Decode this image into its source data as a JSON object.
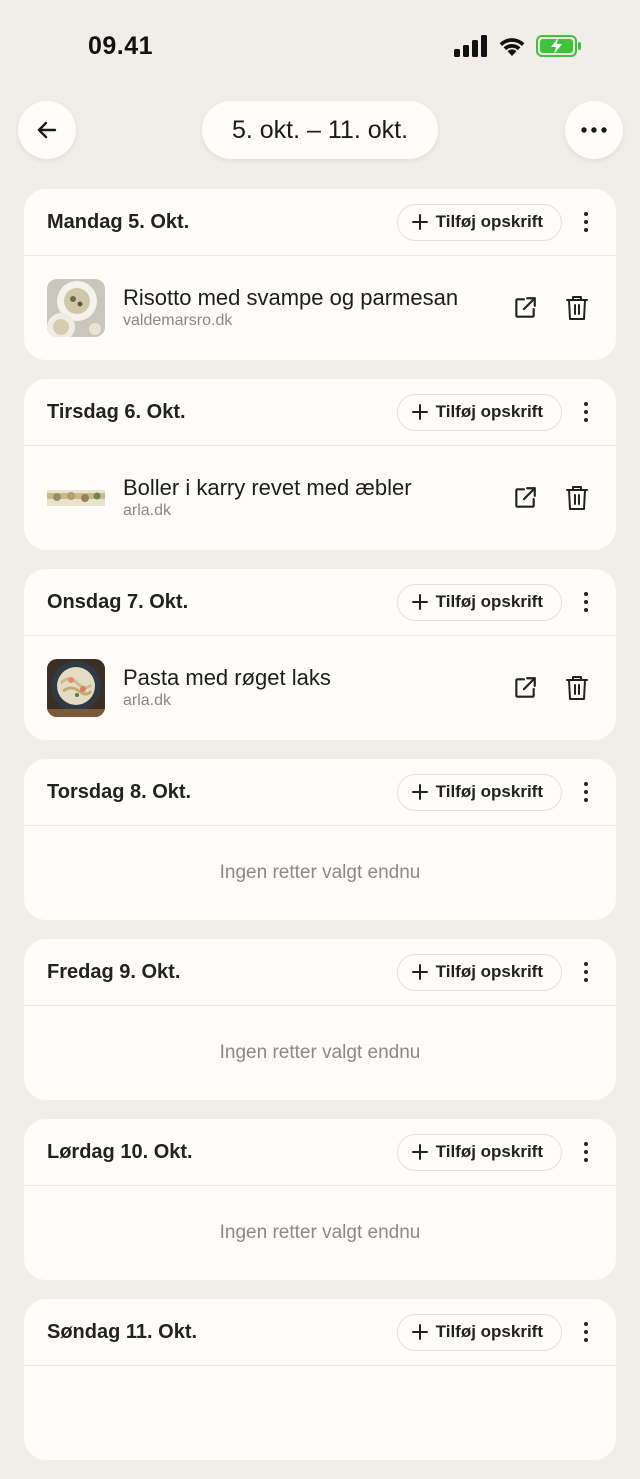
{
  "status": {
    "time": "09.41"
  },
  "nav": {
    "week_range": "5. okt. – 11. okt."
  },
  "add_label": "Tilføj opskrift",
  "empty_label": "Ingen retter valgt endnu",
  "days": [
    {
      "title": "Mandag 5. Okt.",
      "recipe": {
        "title": "Risotto med svampe og parmesan",
        "source": "valdemarsro.dk"
      }
    },
    {
      "title": "Tirsdag 6. Okt.",
      "recipe": {
        "title": "Boller i karry revet med æbler",
        "source": "arla.dk"
      }
    },
    {
      "title": "Onsdag 7. Okt.",
      "recipe": {
        "title": "Pasta med røget laks",
        "source": "arla.dk"
      }
    },
    {
      "title": "Torsdag 8. Okt."
    },
    {
      "title": "Fredag 9. Okt."
    },
    {
      "title": "Lørdag 10. Okt."
    },
    {
      "title": "Søndag 11. Okt."
    }
  ],
  "colors": {
    "background": "#f1eee9",
    "card": "#fdfcf8",
    "battery": "#3ec43a"
  }
}
